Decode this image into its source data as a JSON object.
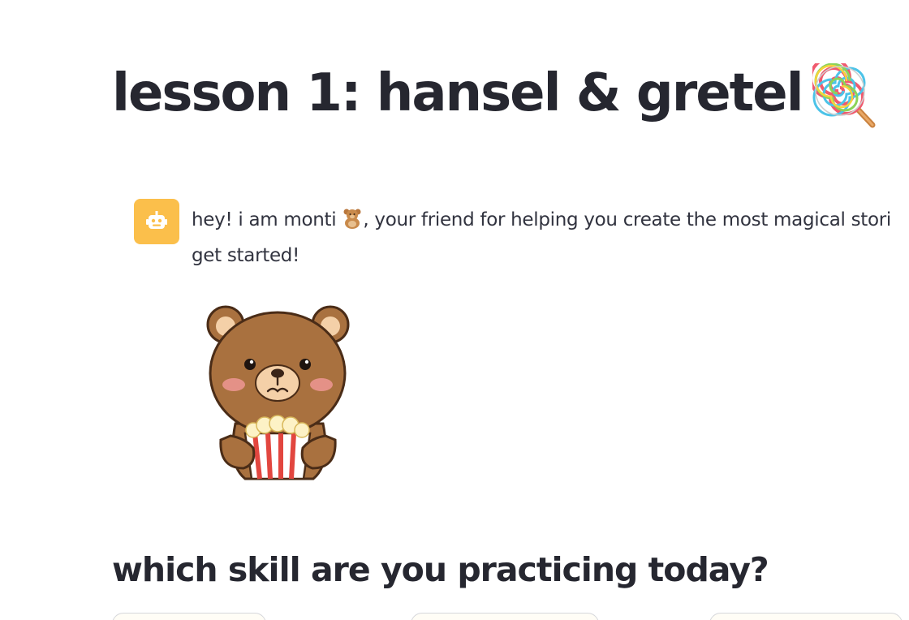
{
  "page": {
    "title": "lesson 1: hansel & gretel",
    "title_emoji": "lollipop-icon"
  },
  "chat": {
    "avatar_icon": "robot-icon",
    "avatar_color": "#fbbf4b",
    "message_part1": "hey! i am monti",
    "message_emoji": "teddy-bear-icon",
    "message_part2": ", your friend for helping you create the most magical stori",
    "message_line2": "get started!"
  },
  "skills": {
    "question": "which skill are you practicing today?",
    "buttons": [
      "",
      "",
      ""
    ]
  }
}
